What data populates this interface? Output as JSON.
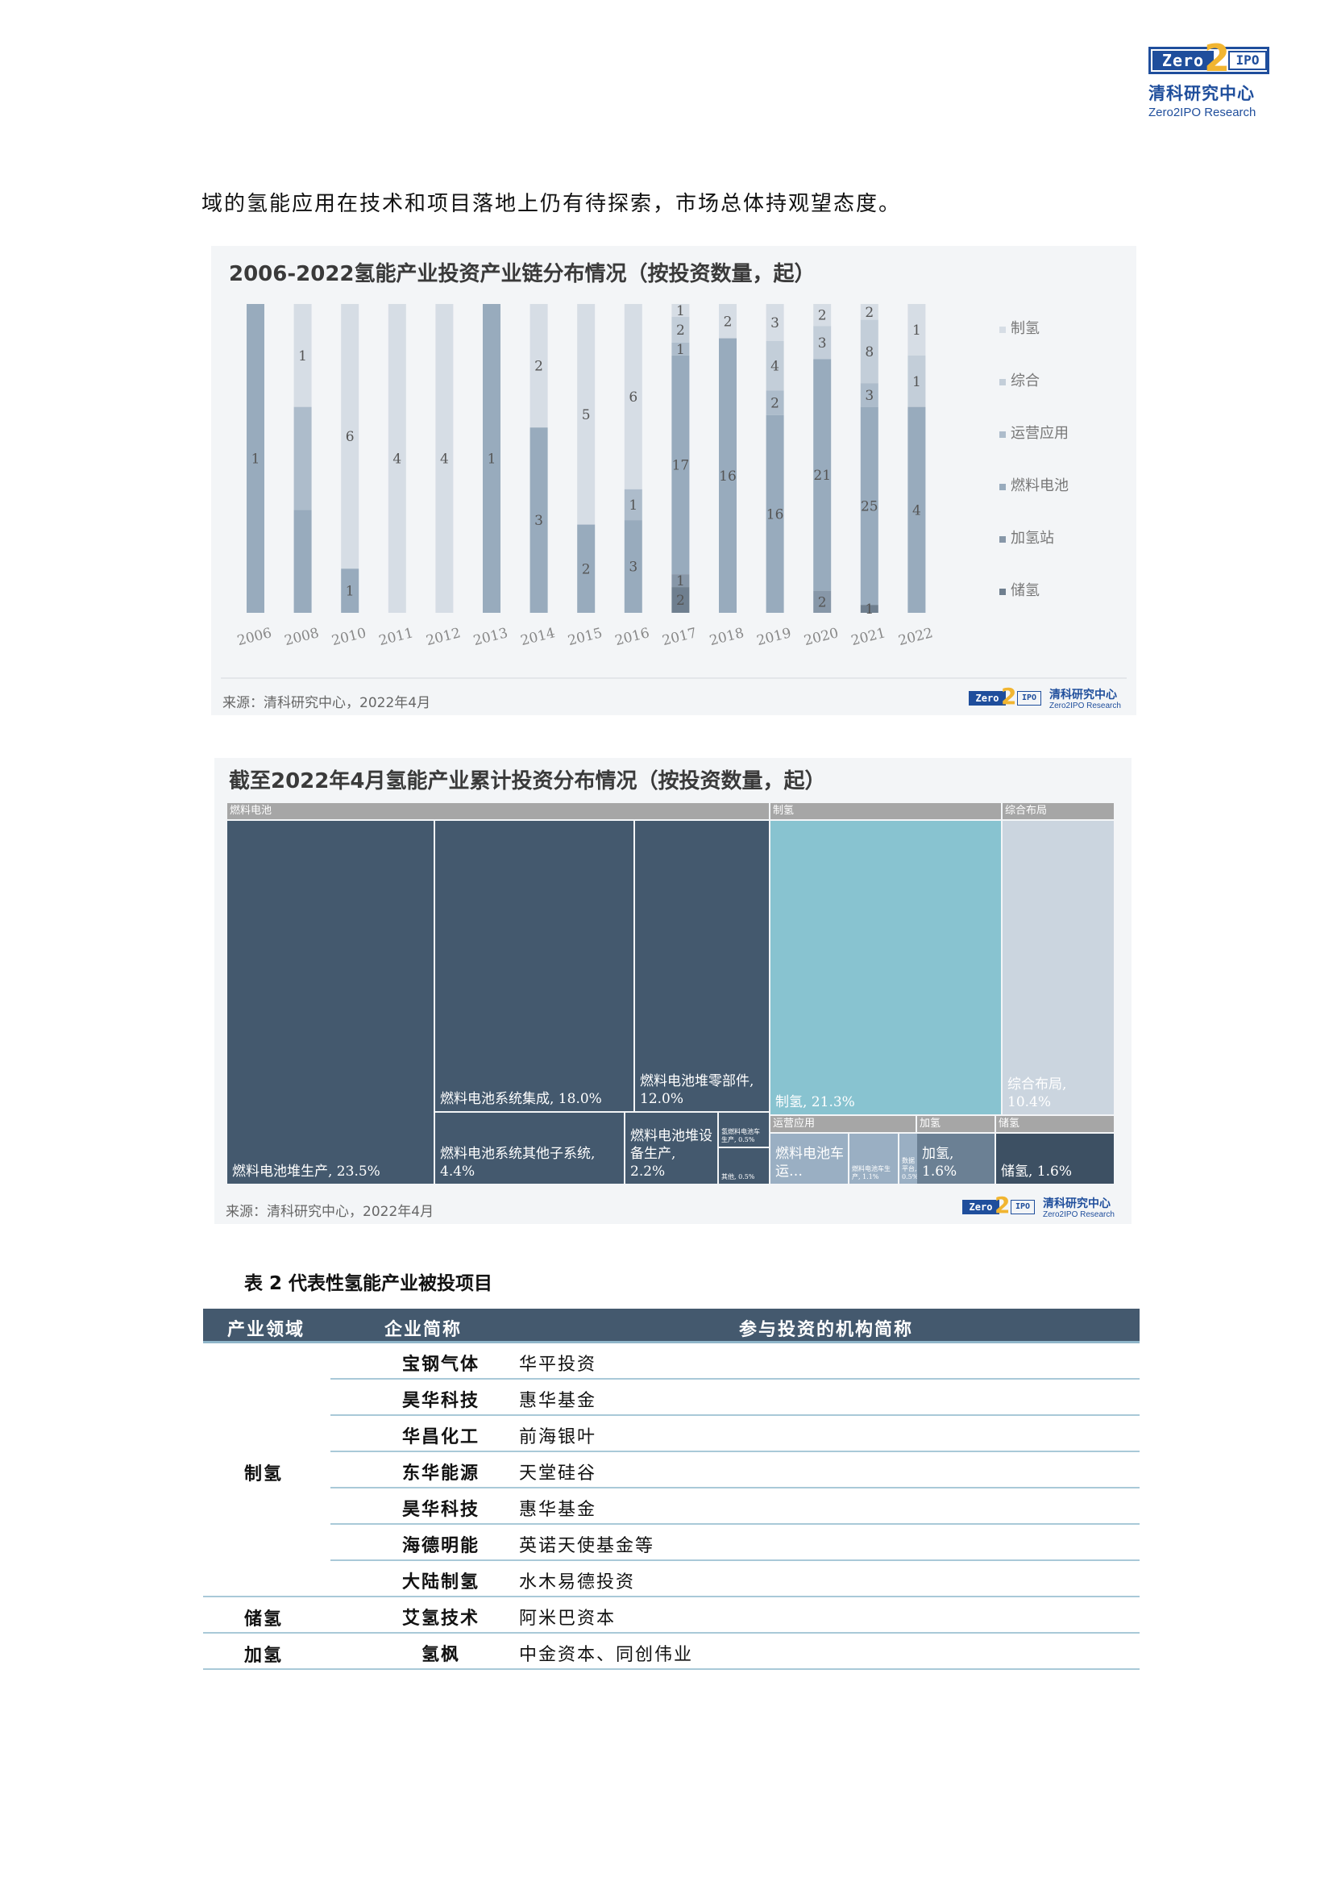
{
  "header": {
    "logo": {
      "zero": "Zero",
      "two": "2",
      "ipo": "IPO",
      "name_cn": "清科研究中心",
      "name_en": "Zero2IPO Research"
    }
  },
  "intro_text": "域的氢能应用在技术和项目落地上仍有待探索，市场总体持观望态度。",
  "chart1": {
    "source": "来源：清科研究中心，2022年4月"
  },
  "chart_data": [
    {
      "type": "bar",
      "stacked": "percent",
      "title": "2006-2022氢能产业投资产业链分布情况（按投资数量，起）",
      "xlabel": "",
      "ylabel": "",
      "categories": [
        "2006",
        "2008",
        "2010",
        "2011",
        "2012",
        "2013",
        "2014",
        "2015",
        "2016",
        "2017",
        "2018",
        "2019",
        "2020",
        "2021",
        "2022"
      ],
      "legend_position": "right",
      "series": [
        {
          "name": "制氢",
          "color": "#d6dde5",
          "values": [
            0,
            1,
            6,
            4,
            4,
            0,
            2,
            5,
            6,
            1,
            2,
            3,
            2,
            2,
            1
          ]
        },
        {
          "name": "综合",
          "color": "#c3ced9",
          "values": [
            0,
            0,
            0,
            0,
            0,
            0,
            0,
            0,
            0,
            2,
            0,
            4,
            3,
            8,
            1
          ]
        },
        {
          "name": "运营应用",
          "color": "#adbccb",
          "values": [
            0,
            1,
            0,
            0,
            0,
            0,
            0,
            0,
            1,
            1,
            0,
            2,
            0,
            3,
            0
          ]
        },
        {
          "name": "燃料电池",
          "color": "#98abbd",
          "values": [
            1,
            1,
            1,
            0,
            0,
            1,
            3,
            2,
            3,
            17,
            16,
            16,
            21,
            25,
            4
          ]
        },
        {
          "name": "加氢站",
          "color": "#8797a8",
          "values": [
            0,
            0,
            0,
            0,
            0,
            0,
            0,
            0,
            0,
            1,
            0,
            0,
            2,
            0,
            0
          ]
        },
        {
          "name": "储氢",
          "color": "#6f7f8f",
          "values": [
            0,
            0,
            0,
            0,
            0,
            0,
            0,
            0,
            0,
            2,
            0,
            0,
            0,
            1,
            0
          ]
        }
      ],
      "hidden_labels": {
        "2008": [
          "运营应用",
          "燃料电池"
        ]
      },
      "grid": false
    },
    {
      "type": "treemap",
      "title": "截至2022年4月氢能产业累计投资分布情况（按投资数量，起）",
      "unit": "%",
      "groups": [
        {
          "name": "燃料电池",
          "items": [
            {
              "label": "燃料电池堆生产",
              "value": 23.5,
              "display": "燃料电池堆生产, 23.5%"
            },
            {
              "label": "燃料电池系统集成",
              "value": 18.0,
              "display": "燃料电池系统集成, 18.0%"
            },
            {
              "label": "燃料电池堆零部件",
              "value": 12.0,
              "display": "燃料电池堆零部件, 12.0%"
            },
            {
              "label": "燃料电池系统其他子系统",
              "value": 4.4,
              "display": "燃料电池系统其他子系统, 4.4%"
            },
            {
              "label": "燃料电池堆设备生产",
              "value": 2.2,
              "display": "燃料电池堆设备生产, 2.2%"
            },
            {
              "label": "氢燃料电池车生产",
              "value": 0.5,
              "display": "氢燃料电池车生产, 0.5%"
            },
            {
              "label": "其他",
              "value": 0.5,
              "display": "其他, 0.5%"
            }
          ]
        },
        {
          "name": "制氢",
          "items": [
            {
              "label": "制氢",
              "value": 21.3,
              "display": "制氢, 21.3%"
            }
          ]
        },
        {
          "name": "综合布局",
          "items": [
            {
              "label": "综合布局",
              "value": 10.4,
              "display": "综合布局, 10.4%"
            }
          ]
        },
        {
          "name": "运营应用",
          "items": [
            {
              "label": "燃料电池车运营",
              "value": null,
              "display": "燃料电池车运…"
            },
            {
              "label": "燃料电池车生产",
              "value": 1.1,
              "display": "燃料电池车生产, 1.1%"
            },
            {
              "label": "数据平台",
              "value": 0.5,
              "display": "数据平台, 0.5%"
            },
            {
              "label": "燃料电池船舶",
              "value": 0.5,
              "display": "燃料电池船舶, 0.5%"
            }
          ]
        },
        {
          "name": "加氢",
          "items": [
            {
              "label": "加氢",
              "value": 1.6,
              "display": "加氢, 1.6%"
            }
          ]
        },
        {
          "name": "储氢",
          "items": [
            {
              "label": "储氢",
              "value": 1.6,
              "display": "储氢, 1.6%"
            }
          ]
        }
      ]
    }
  ],
  "chart2": {
    "source": "来源：清科研究中心，2022年4月"
  },
  "table": {
    "caption": "表 2  代表性氢能产业被投项目",
    "headers": [
      "产业领域",
      "企业简称",
      "参与投资的机构简称"
    ],
    "groups": [
      {
        "sector": "制氢",
        "rows": [
          {
            "company": "宝钢气体",
            "investors": "华平投资"
          },
          {
            "company": "昊华科技",
            "investors": "惠华基金"
          },
          {
            "company": "华昌化工",
            "investors": "前海银叶"
          },
          {
            "company": "东华能源",
            "investors": "天堂硅谷"
          },
          {
            "company": "昊华科技",
            "investors": "惠华基金"
          },
          {
            "company": "海德明能",
            "investors": "英诺天使基金等"
          },
          {
            "company": "大陆制氢",
            "investors": "水木易德投资"
          }
        ]
      },
      {
        "sector": "储氢",
        "rows": [
          {
            "company": "艾氢技术",
            "investors": "阿米巴资本"
          }
        ]
      },
      {
        "sector": "加氢",
        "rows": [
          {
            "company": "氢枫",
            "investors": "中金资本、同创伟业"
          }
        ]
      }
    ]
  }
}
